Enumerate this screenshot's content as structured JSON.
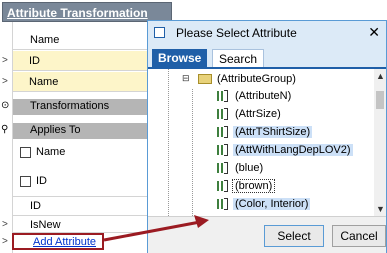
{
  "background_panel": {
    "title": "Attribute Transformation",
    "rows": [
      {
        "label": "Name"
      },
      {
        "label": "ID"
      },
      {
        "label": "Name"
      }
    ],
    "sections": {
      "transformations": "Transformations",
      "applies_to": "Applies To"
    },
    "checkboxes": [
      {
        "label": "Name"
      },
      {
        "label": "ID"
      }
    ],
    "lower_rows": [
      {
        "label": "ID"
      },
      {
        "label": "IsNew"
      }
    ],
    "add_attribute_link": "Add Attribute"
  },
  "dialog": {
    "title": "Please Select Attribute",
    "close_glyph": "✕",
    "tabs": [
      {
        "label": "Browse",
        "active": true
      },
      {
        "label": "Search",
        "active": false
      }
    ],
    "tree": {
      "group": "(AttributeGroup)",
      "items": [
        {
          "label": "(AttributeN)",
          "selected": false
        },
        {
          "label": "(AttrSize)",
          "selected": false
        },
        {
          "label": "(AttrTShirtSize)",
          "selected": true
        },
        {
          "label": "(AttWithLangDepLOV2)",
          "selected": true
        },
        {
          "label": "(blue)",
          "selected": false
        },
        {
          "label": "(brown)",
          "selected": false,
          "focused": true
        },
        {
          "label": "(Color, Interior)",
          "selected": true
        }
      ]
    },
    "buttons": {
      "select": "Select",
      "cancel": "Cancel"
    }
  },
  "colors": {
    "accent": "#1f5fa8",
    "selection": "#cce0f7",
    "highlight_row": "#fdf5c9",
    "annotation_arrow": "#9b1b22"
  },
  "icons": {
    "expand": "chevron-right-icon",
    "collapse": "minus-box-icon",
    "folder": "folder-icon",
    "attribute": "attribute-icon"
  }
}
